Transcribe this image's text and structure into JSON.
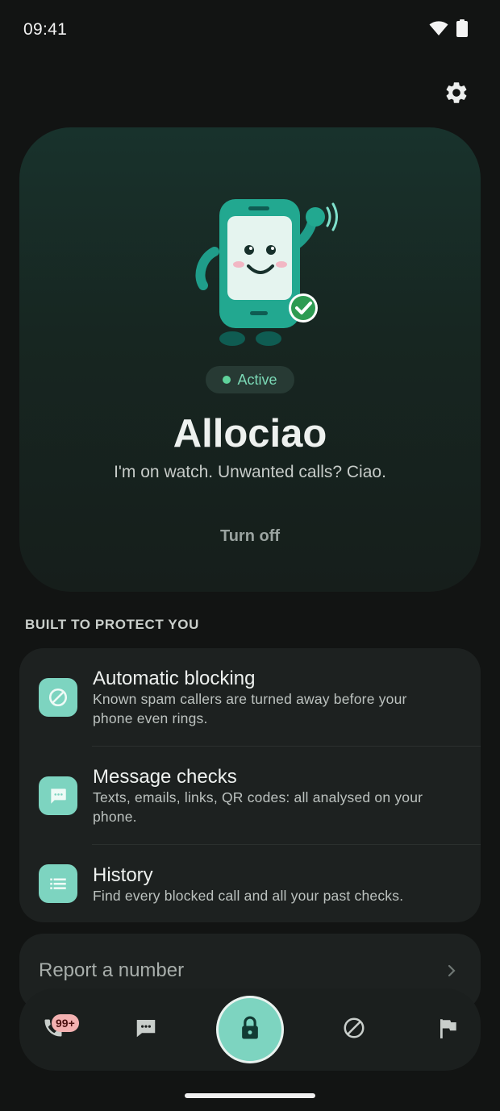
{
  "status_bar": {
    "time": "09:41"
  },
  "hero": {
    "status_label": "Active",
    "title": "Allociao",
    "tagline": "I'm on watch. Unwanted calls? Ciao.",
    "turn_off_label": "Turn off"
  },
  "features": {
    "heading": "BUILT TO PROTECT YOU",
    "items": [
      {
        "title": "Automatic blocking",
        "description": "Known spam callers are turned away before your phone even rings.",
        "icon": "block-icon"
      },
      {
        "title": "Message checks",
        "description": "Texts, emails, links, QR codes: all analysed on your phone.",
        "icon": "message-icon"
      },
      {
        "title": "History",
        "description": "Find every blocked call and all your past checks.",
        "icon": "list-icon"
      }
    ]
  },
  "report": {
    "label": "Report a number"
  },
  "bottom_nav": {
    "calls_badge": "99+",
    "items": [
      "phone-icon",
      "message-icon",
      "lock-icon",
      "block-icon",
      "flag-icon"
    ]
  },
  "colors": {
    "accent": "#7dd4c0",
    "active_green": "#5fd29b",
    "background": "#121413",
    "card": "#1d2120"
  }
}
